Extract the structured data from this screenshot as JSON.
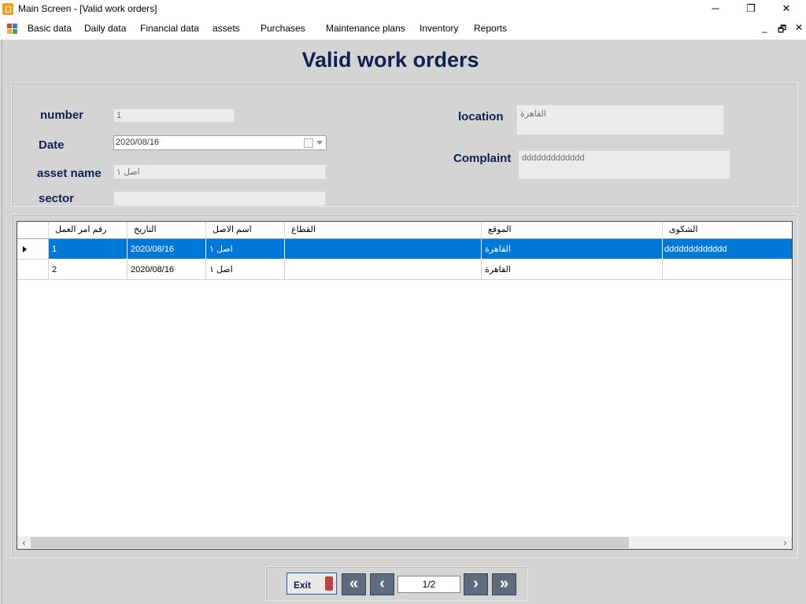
{
  "window": {
    "title": "Main Screen - [Valid work orders]",
    "minimize": "─",
    "maximize": "❐",
    "close": "✕"
  },
  "menu": {
    "items": [
      "Basic data",
      "Daily data",
      "Financial data",
      "assets",
      "Purchases",
      "Maintenance plans",
      "Inventory",
      "Reports"
    ],
    "mdi_minimize": "_",
    "mdi_restore": "🗗",
    "mdi_close": "✕"
  },
  "form": {
    "title": "Valid work orders",
    "number_label": "number",
    "number_value": "1",
    "date_label": "Date",
    "date_value": "2020/08/16",
    "asset_label": "asset  name",
    "asset_value": "اصل ١",
    "sector_label": "sector",
    "sector_value": "",
    "location_label": "location",
    "location_value": "القاهرة",
    "complaint_label": "Complaint",
    "complaint_value": "ddddddddddddd"
  },
  "grid": {
    "columns": [
      "رقم امر العمل",
      "التاريخ",
      "اسم الاصل",
      "القطاع",
      "الموقع",
      "الشكوى"
    ],
    "rows": [
      {
        "cells": [
          "1",
          "2020/08/16",
          "اصل ١",
          "",
          "القاهرة",
          "ddddddddddddd"
        ],
        "selected": true
      },
      {
        "cells": [
          "2",
          "2020/08/16",
          "اصل ١",
          "",
          "القاهرة",
          ""
        ],
        "selected": false
      }
    ]
  },
  "footer": {
    "exit_label": "Exit",
    "first": "«",
    "prev": "‹",
    "page_indicator": "1/2",
    "next": "›",
    "last": "»"
  }
}
